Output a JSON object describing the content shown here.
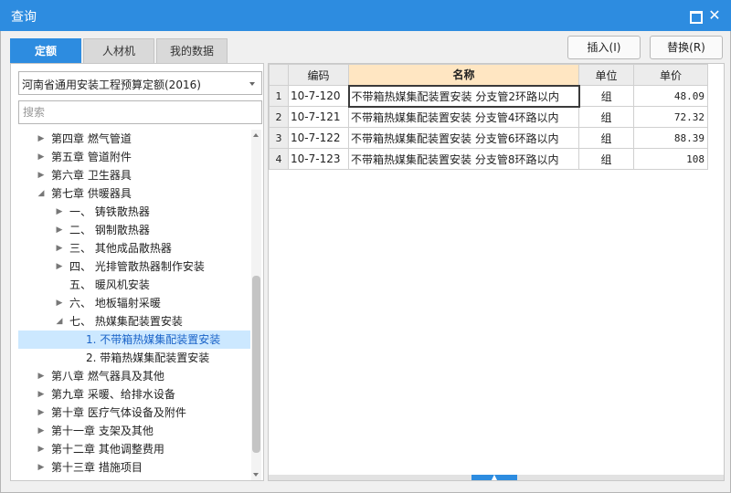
{
  "window": {
    "title": "查询",
    "close_glyph": "✕",
    "icons": {
      "maximize": "maximize-icon",
      "close": "close-icon"
    }
  },
  "tabs": [
    {
      "label": "定额",
      "active": true
    },
    {
      "label": "人材机",
      "active": false
    },
    {
      "label": "我的数据",
      "active": false
    }
  ],
  "actions": {
    "insert_label": "插入(I)",
    "replace_label": "替换(R)"
  },
  "left": {
    "library_select": {
      "value": "河南省通用安装工程预算定额(2016)"
    },
    "search": {
      "placeholder": "搜索",
      "value": ""
    },
    "tree": [
      {
        "label": "第四章 燃气管道",
        "expander": "▶",
        "level": 0
      },
      {
        "label": "第五章 管道附件",
        "expander": "▶",
        "level": 0
      },
      {
        "label": "第六章 卫生器具",
        "expander": "▶",
        "level": 0
      },
      {
        "label": "第七章 供暖器具",
        "expander": "◢",
        "level": 0
      },
      {
        "label": "一、  铸铁散热器",
        "expander": "▶",
        "level": 1
      },
      {
        "label": "二、  钢制散热器",
        "expander": "▶",
        "level": 1
      },
      {
        "label": "三、  其他成品散热器",
        "expander": "▶",
        "level": 1
      },
      {
        "label": "四、  光排管散热器制作安装",
        "expander": "▶",
        "level": 1
      },
      {
        "label": "五、  暖风机安装",
        "expander": "",
        "level": 1
      },
      {
        "label": "六、  地板辐射采暖",
        "expander": "▶",
        "level": 1
      },
      {
        "label": "七、  热媒集配装置安装",
        "expander": "◢",
        "level": 1
      },
      {
        "label": "1. 不带箱热媒集配装置安装",
        "expander": "",
        "level": 2,
        "selected": true
      },
      {
        "label": "2. 带箱热媒集配装置安装",
        "expander": "",
        "level": 2
      },
      {
        "label": "第八章 燃气器具及其他",
        "expander": "▶",
        "level": 0
      },
      {
        "label": "第九章 采暖、给排水设备",
        "expander": "▶",
        "level": 0
      },
      {
        "label": "第十章 医疗气体设备及附件",
        "expander": "▶",
        "level": 0
      },
      {
        "label": "第十一章 支架及其他",
        "expander": "▶",
        "level": 0
      },
      {
        "label": "第十二章 其他调整费用",
        "expander": "▶",
        "level": 0
      },
      {
        "label": "第十三章 措施项目",
        "expander": "▶",
        "level": 0
      }
    ]
  },
  "table": {
    "columns": {
      "code": "编码",
      "name": "名称",
      "unit": "单位",
      "price": "单价"
    },
    "rows": [
      {
        "num": "1",
        "code": "10-7-120",
        "name": "不带箱热媒集配装置安装 分支管2环路以内",
        "unit": "组",
        "price": "48.09"
      },
      {
        "num": "2",
        "code": "10-7-121",
        "name": "不带箱热媒集配装置安装 分支管4环路以内",
        "unit": "组",
        "price": "72.32"
      },
      {
        "num": "3",
        "code": "10-7-122",
        "name": "不带箱热媒集配装置安装 分支管6环路以内",
        "unit": "组",
        "price": "88.39"
      },
      {
        "num": "4",
        "code": "10-7-123",
        "name": "不带箱热媒集配装置安装 分支管8环路以内",
        "unit": "组",
        "price": "108"
      }
    ]
  },
  "colors": {
    "accent": "#2d8ce0",
    "selected_row_bg": "#cce8ff",
    "name_header_bg": "#ffe6c2"
  }
}
